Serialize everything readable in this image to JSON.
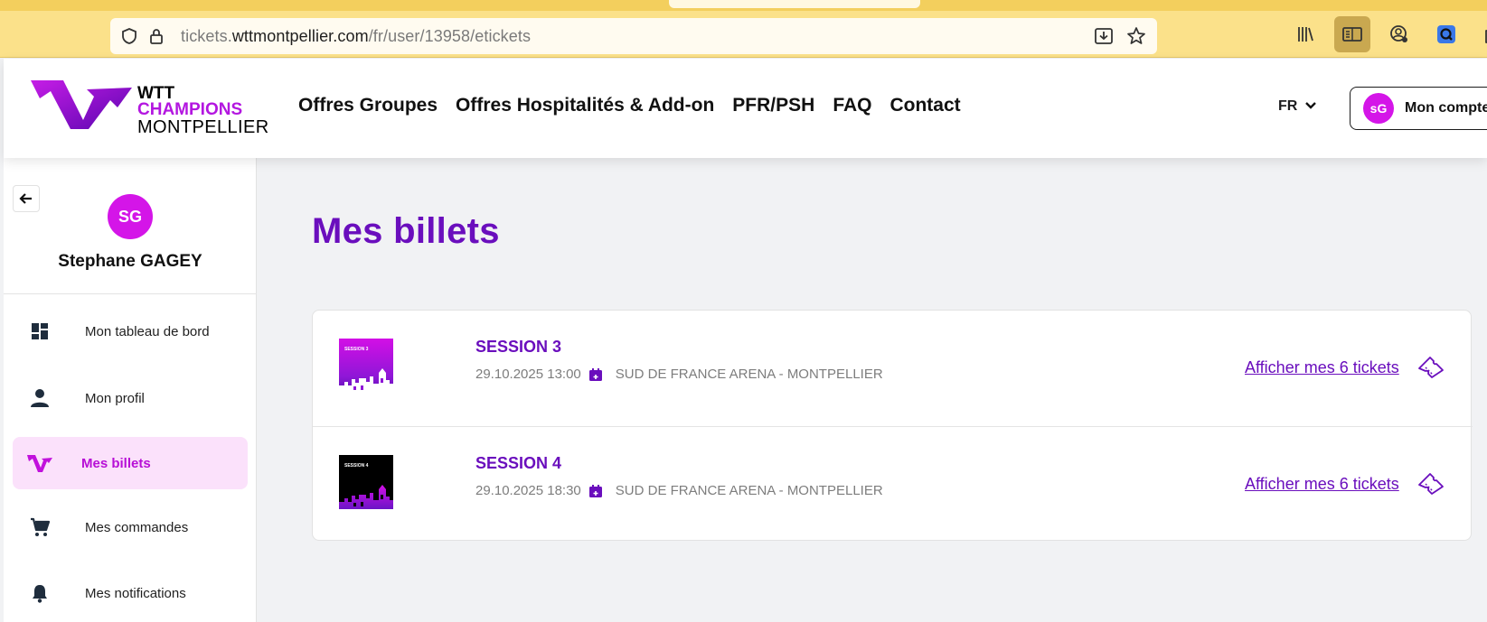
{
  "browser": {
    "url_prefix": "tickets.",
    "url_domain": "wttmontpellier.com",
    "url_path": "/fr/user/13958/etickets"
  },
  "header": {
    "logo": {
      "line1": "WTT",
      "line2": "CHAMPIONS",
      "line3": "MONTPELLIER"
    },
    "nav": [
      "Offres Groupes",
      "Offres Hospitalités & Add-on",
      "PFR/PSH",
      "FAQ",
      "Contact"
    ],
    "language": "FR",
    "account": {
      "initials": "sG",
      "label": "Mon compte"
    }
  },
  "sidebar": {
    "initials": "SG",
    "name": "Stephane GAGEY",
    "items": [
      {
        "label": "Mon tableau de bord",
        "icon": "dashboard-icon",
        "active": false
      },
      {
        "label": "Mon profil",
        "icon": "person-icon",
        "active": false
      },
      {
        "label": "Mes billets",
        "icon": "wtt-ticket-icon",
        "active": true
      },
      {
        "label": "Mes commandes",
        "icon": "cart-icon",
        "active": false
      },
      {
        "label": "Mes notifications",
        "icon": "bell-icon",
        "active": false
      }
    ]
  },
  "main": {
    "title": "Mes billets",
    "tickets": [
      {
        "thumb_label": "SESSION 3",
        "title": "SESSION 3",
        "datetime": "29.10.2025 13:00",
        "venue": "SUD DE FRANCE ARENA - MONTPELLIER",
        "link": "Afficher mes 6 tickets"
      },
      {
        "thumb_label": "SESSION 4",
        "title": "SESSION 4",
        "datetime": "29.10.2025 18:30",
        "venue": "SUD DE FRANCE ARENA - MONTPELLIER",
        "link": "Afficher mes 6 tickets"
      }
    ]
  },
  "colors": {
    "brand_purple": "#6a0ebd",
    "brand_magenta": "#d415e8",
    "browser_bar": "#fbe18a"
  }
}
